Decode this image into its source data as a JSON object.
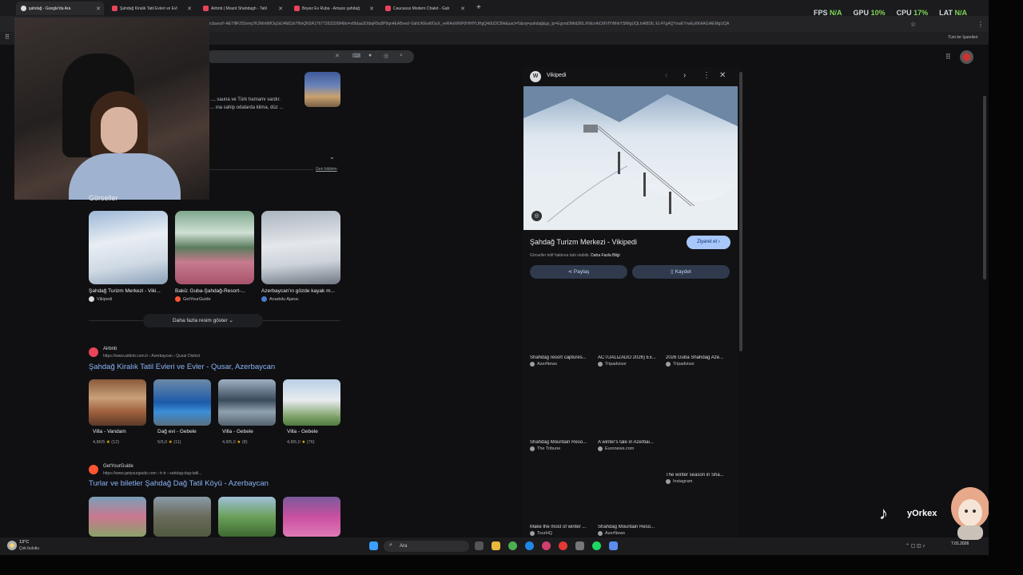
{
  "perf": {
    "fps_label": "FPS",
    "fps_value": "N/A",
    "gpu_label": "GPU",
    "gpu_value": "10%",
    "cpu_label": "CPU",
    "cpu_value": "17%",
    "lat_label": "LAT",
    "lat_value": "N/A"
  },
  "tabs": [
    {
      "title": "şahdağ - Google'da Ara",
      "active": true
    },
    {
      "title": "Şahdağ Kiralık Tatil Evleri ve Evl",
      "active": false
    },
    {
      "title": "Airbnb | Mount Shahdagh - Tatil",
      "active": false
    },
    {
      "title": "Boyez Ev Ruba - Amaze şahdağ",
      "active": false
    },
    {
      "title": "Caucasus Modern Chalet - Gab",
      "active": false
    }
  ],
  "address": {
    "url": "c5cbuesrf~AETflfFZfZvmq7K2MmMfOq1kU4MZzk7f6nQN3A17677393326848ei=xf9daa3OtbqR9u8P9qn4EABved~0ahUKEwitIOuX_veRAxW6IP0HHfYUHgQ4dUDCBA&uact=5&oq=şahdağ&gs_lp=Egxnd3Mtd2l6LXNlcnAiCMVfYWhkYSfMgUQLhiABDIL EL4YgAQYxwEYrwEy8KAAGIAEMgUQA",
    "bookmarks_label": "Tüm ler İşaretleri"
  },
  "snippet": {
    "line1": "..., sauna ve Türk hamamı vardır.",
    "line2": "... ına sahip odalarda klima, düz ...",
    "feedback": "Geri bildirim"
  },
  "images": {
    "heading": "Görseller",
    "items": [
      {
        "caption": "Şahdağ Turizm Merkezi - Viki...",
        "source": "Vikipedi",
        "color": "#dadce0"
      },
      {
        "caption": "Bakü: Guba-Şahdağ-Resort-...",
        "source": "GetYourGuide",
        "color": "#ff5533"
      },
      {
        "caption": "Azerbaycan'ın gözde kayak m...",
        "source": "Anadolu Ajansı",
        "color": "#4a7bd0"
      }
    ],
    "more_label": "Daha fazla resim göster"
  },
  "result1": {
    "site": "Airbnb",
    "url": "https://www.airbnb.com.tr › Azerbaycan › Qusar District",
    "title": "Şahdağ Kiralık Tatil Evleri ve Evler - Qusar, Azerbaycan",
    "villas": [
      {
        "name": "Villa - Vandam",
        "rating": "4,86/5",
        "reviews": "(12)"
      },
      {
        "name": "Dağ evi - Gebele",
        "rating": "5/5,0",
        "reviews": "(11)"
      },
      {
        "name": "Villa - Gebele",
        "rating": "4,8/5,0",
        "reviews": "(8)"
      },
      {
        "name": "Villa - Gebele",
        "rating": "4,8/5,0",
        "reviews": "(76)"
      }
    ]
  },
  "result2": {
    "site": "GetYourGuide",
    "url": "https://www.getyourguide.com › tr-tr › sahdag-dag-tatil...",
    "title": "Turlar ve biletler Şahdağ Dağ Tatil Köyü - Azerbaycan"
  },
  "panel": {
    "source": "Vikipedi",
    "title": "Şahdağ Turizm Merkezi - Vikipedi",
    "visit": "Ziyaret et",
    "note": "Görseller telif hakkına tabi olabilir.",
    "note_link": "Daha Fazla Bilgi",
    "share": "Paylaş",
    "save": "Kaydet",
    "related": [
      {
        "caption": "Shahdag resort captures...",
        "source": "AzerNews"
      },
      {
        "caption": "ACTUALIZADO 2026) Ex...",
        "source": "Tripadvisor"
      },
      {
        "caption": "2026 Guba Shahdag Aze...",
        "source": "Tripadvisor"
      },
      {
        "caption": "Shahdag Mountain Reso...",
        "source": "The Tribune"
      },
      {
        "caption": "A winter's tale in Azerbai...",
        "source": "Euronews.com"
      },
      {
        "caption": "The winter season in Sha...",
        "source": "Instagram"
      },
      {
        "caption": "Make the most of winter ...",
        "source": "TourHQ"
      },
      {
        "caption": "Shahdag Mountain Reso...",
        "source": "AzerNews"
      }
    ]
  },
  "taskbar": {
    "temp": "13°C",
    "weather": "Çok bulutlu",
    "search": "Ara",
    "time": "7.01.2026"
  },
  "tiktok": {
    "username": "yOrkex"
  }
}
